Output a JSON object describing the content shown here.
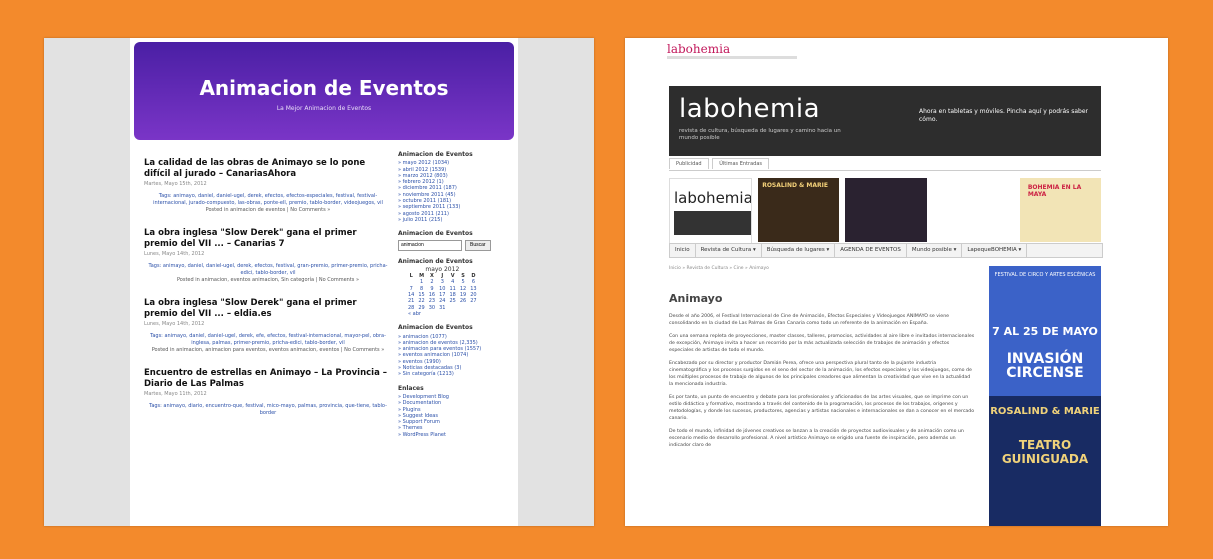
{
  "left": {
    "header": {
      "title": "Animacion de Eventos",
      "subtitle": "La Mejor Animacion de Eventos"
    },
    "posts": [
      {
        "title": "La calidad de las obras de Animayo se lo pone difícil al jurado – CanariasAhora",
        "date": "Martes, Mayo 15th, 2012",
        "tags": "Tags: animayo, daniel, daniel-ugel, derek, efectos, efectos-especiales, festival, festival-internacional, jurado-compuesto, las-obras, ponte-ell, premio, tablo-border, videojuegos, vil",
        "posted": "Posted in animacion de eventos | No Comments »"
      },
      {
        "title": "La obra inglesa \"Slow Derek\" gana el primer premio del VII ... – Canarias 7",
        "date": "Lunes, Mayo 14th, 2012",
        "tags": "Tags: animayo, daniel, daniel-ugel, derek, efectos, festival, gran-premio, primer-premio, pricha-edici, tablo-border, vil",
        "posted": "Posted in animacion, eventos animacion, Sin categoría | No Comments »"
      },
      {
        "title": "La obra inglesa \"Slow Derek\" gana el primer premio del VII ... – eldia.es",
        "date": "Lunes, Mayo 14th, 2012",
        "tags": "Tags: animayo, daniel, daniel-ugel, derek, efe, efectos, festival-internacional, mayor-pel, obra-inglesa, palmas, primer-premio, pricha-edici, tablo-border, vil",
        "posted": "Posted in animacion, animacion para eventos, eventos animacion, eventos | No Comments »"
      },
      {
        "title": "Encuentro de estrellas en Animayo – La Provincia – Diario de Las Palmas",
        "date": "Martes, Mayo 11th, 2012",
        "tags": "Tags: animayo, diario, encuentro-que, festival, mico-mayo, palmas, provincia, que-tiene, tablo-border",
        "posted": ""
      }
    ],
    "sidebar": {
      "archive_title": "Animacion de Eventos",
      "archive": [
        "» mayo 2012 (1034)",
        "» abril 2012 (1539)",
        "» marzo 2012 (803)",
        "» febrero 2012 (1)",
        "» diciembre 2011 (187)",
        "» noviembre 2011 (45)",
        "» octubre 2011 (181)",
        "» septiembre 2011 (133)",
        "» agosto 2011 (211)",
        "» julio 2011 (215)"
      ],
      "search_title": "Animacion de Eventos",
      "search_value": "animacion",
      "search_button": "Buscar",
      "calendar_title": "Animacion de Eventos",
      "calendar_caption": "mayo 2012",
      "calendar_head": [
        "L",
        "M",
        "X",
        "J",
        "V",
        "S",
        "D"
      ],
      "calendar_rows": [
        [
          "",
          "1",
          "2",
          "3",
          "4",
          "5",
          "6"
        ],
        [
          "7",
          "8",
          "9",
          "10",
          "11",
          "12",
          "13"
        ],
        [
          "14",
          "15",
          "16",
          "17",
          "18",
          "19",
          "20"
        ],
        [
          "21",
          "22",
          "23",
          "24",
          "25",
          "26",
          "27"
        ],
        [
          "28",
          "29",
          "30",
          "31",
          "",
          "",
          ""
        ]
      ],
      "calendar_prev": "« abr",
      "categories_title": "Animacion de Eventos",
      "categories": [
        "» animacion (1077)",
        "» animacion de eventos (2,335)",
        "» animacion para eventos (1557)",
        "» eventos animacion (1074)",
        "» eventos (1990)",
        "» Noticias destacadas (3)",
        "» Sin categoría (1213)"
      ],
      "links_title": "Enlaces",
      "links": [
        "» Development Blog",
        "» Documentation",
        "» Plugins",
        "» Suggest Ideas",
        "» Support Forum",
        "» Themes",
        "» WordPress Planet"
      ]
    }
  },
  "right": {
    "small_logo": "labohemia",
    "banner_logo": "labohemia",
    "banner_tagline": "revista de cultura, búsqueda de lugares y camino hacia un mundo posible",
    "banner_promo": "Ahora en tabletas y móviles. Pincha aquí y podrás saber cómo.",
    "tabs": [
      "Publicidad",
      "Últimas Entradas"
    ],
    "thumbs": [
      "labohemia",
      "ROSALIND & MARIE",
      "",
      "",
      "BOHEMIA EN LA MAYA"
    ],
    "nav": [
      "Inicio",
      "Revista de Cultura ▾",
      "Búsqueda de lugares ▾",
      "AGENDA DE EVENTOS",
      "Mundo posible ▾",
      "LapequeBOHEMIA ▾"
    ],
    "breadcrumb": "Inicio » Revista de Cultura » Cine » Animayo",
    "article_title": "Animayo",
    "paragraphs": [
      "Desde el año 2006, el Festival Internacional de Cine de Animación, Efectos Especiales y Videojuegos ANIMAYO se viene consolidando en la ciudad de Las Palmas de Gran Canaria como todo un referente de la animación en España.",
      "Con una semana repleta de proyecciones, master classes, talleres, promocios, actividades al aire libre e invitados internacionales de excepción, Animayo invita a hacer un recorrido por la más actualizada selección de trabajos de animación y efectos especiales de artistas de todo el mundo.",
      "Encabezado por su director y productor Damián Perea, ofrece una perspectiva plural tanto de la pujante industria cinematográfica y los procesos surgidos en el seno del sector de la animación, los efectos especiales y los videojuegos, como de los múltiples procesos de trabajo de algunos de los principales creadores que alimentan la creatividad que vive en la actualidad la mencionada industria.",
      "Es por tanto, un punto de encuentro y debate para los profesionales y aficionados de las artes visuales, que se imprime con un estilo didáctico y formativo, mostrando a través del contenido de la programación, los procesos de los trabajos, orígenes y metodologías, y donde los sucesos, productores, agencias y artistas nacionales e internacionales se dan a conocer en el mercado canario.",
      "De todo el mundo, infinidad de jóvenes creativos se lanzan a la creación de proyectos audiovisuales y de animación como un escenario medio de desarrollo profesional. A nivel artístico Animayo se erigido una fuente de inspiración, pero además un indicador claro de"
    ],
    "director_name": "Damián Perea",
    "ad_top": "FESTIVAL DE CIRCO Y ARTES ESCÉNICAS",
    "ad_date": "7 AL 25 DE MAYO",
    "ad_big": "INVASIÓN CIRCENSE",
    "ad_b1": "ROSALIND & MARIE",
    "ad_b2": "TEATRO GUINIGUADA"
  }
}
